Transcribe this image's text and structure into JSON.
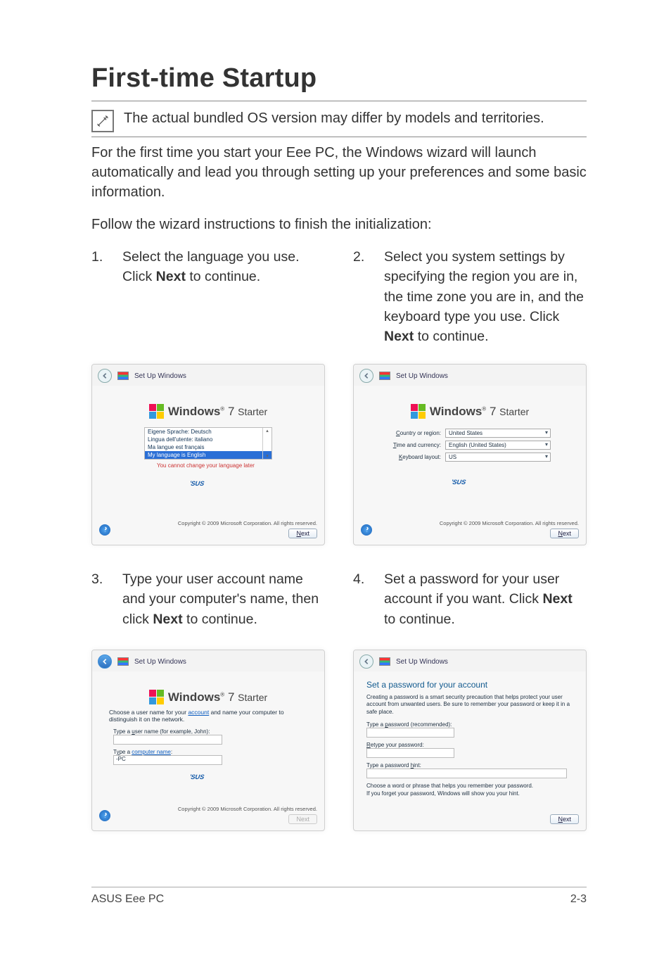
{
  "page": {
    "title": "First-time Startup",
    "note": "The actual bundled OS version may differ by models and territories.",
    "para1": "For the first time you start your Eee PC, the Windows wizard will launch automatically and lead you through setting up your preferences and some basic information.",
    "para2": "Follow the wizard instructions to finish the initialization:",
    "footer_left": "ASUS Eee PC",
    "footer_right": "2-3"
  },
  "steps": [
    {
      "n": "1.",
      "t1": "Select the language you use. Click ",
      "b": "Next",
      "t2": " to continue."
    },
    {
      "n": "2.",
      "t1": "Select you system settings by specifying the region you are in, the time zone you are in, and the keyboard type you use. Click ",
      "b": "Next",
      "t2": " to continue."
    },
    {
      "n": "3.",
      "t1": "Type your user account name and your computer's name, then click ",
      "b": "Next",
      "t2": " to continue."
    },
    {
      "n": "4.",
      "t1": "Set a password for your user account if you want. Click ",
      "b": "Next",
      "t2": " to continue."
    }
  ],
  "win": {
    "title": "Set Up Windows",
    "brand": "Windows",
    "brand_ver": "7",
    "brand_ed": "Starter",
    "copyright": "Copyright © 2009 Microsoft Corporation.  All rights reserved.",
    "next": "Next",
    "next_u": "N"
  },
  "s1": {
    "langs": [
      "Eigene Sprache: Deutsch",
      "Lingua dell'utente: italiano",
      "Ma langue est français",
      "My language is English"
    ],
    "warn": "You cannot change your language later"
  },
  "s2": {
    "rows": [
      {
        "label_pre": "C",
        "label": "ountry or region:",
        "val": "United States"
      },
      {
        "label_pre": "T",
        "label": "ime and currency:",
        "val": "English (United States)"
      },
      {
        "label_pre": "K",
        "label": "eyboard layout:",
        "val": "US"
      }
    ]
  },
  "s3": {
    "intro_a": "Choose a user name for your ",
    "intro_link": "account",
    "intro_b": " and name your computer to distinguish it on the network.",
    "f1_pre": "Type a ",
    "f1_u": "u",
    "f1_post": "ser name (for example, John):",
    "f2_pre": "T",
    "f2_u": "y",
    "f2_post": "pe a ",
    "f2_link": "computer name",
    "f2_after": ":",
    "pc": "-PC"
  },
  "s4": {
    "heading": "Set a password for your account",
    "intro": "Creating a password is a smart security precaution that helps protect your user account from unwanted users. Be sure to remember your password or keep it in a safe place.",
    "f1": "Type a password (recommended):",
    "f1_u": "p",
    "f2": "Retype your password:",
    "f2_u": "R",
    "f3": "Type a password hint:",
    "f3_u": "h",
    "hint": "Choose a word or phrase that helps you remember your password.\nIf you forget your password, Windows will show you your hint."
  }
}
